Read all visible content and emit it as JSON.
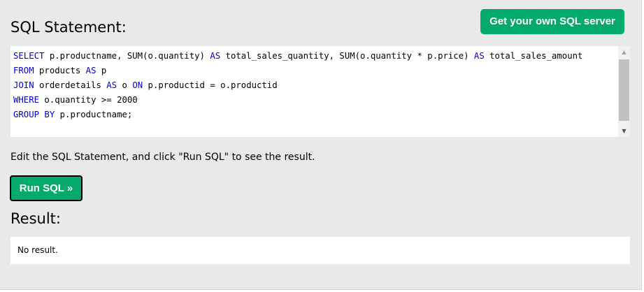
{
  "header": {
    "title": "SQL Statement:",
    "get_server_label": "Get your own SQL server"
  },
  "editor": {
    "lines": [
      [
        {
          "t": "SELECT",
          "kw": true
        },
        {
          "t": " p.productname, SUM(o.quantity) ",
          "kw": false
        },
        {
          "t": "AS",
          "kw": true
        },
        {
          "t": " total_sales_quantity, SUM(o.quantity * p.price) ",
          "kw": false
        },
        {
          "t": "AS",
          "kw": true
        },
        {
          "t": " total_sales_amount",
          "kw": false
        }
      ],
      [
        {
          "t": "FROM",
          "kw": true
        },
        {
          "t": " products ",
          "kw": false
        },
        {
          "t": "AS",
          "kw": true
        },
        {
          "t": " p",
          "kw": false
        }
      ],
      [
        {
          "t": "JOIN",
          "kw": true
        },
        {
          "t": " orderdetails ",
          "kw": false
        },
        {
          "t": "AS",
          "kw": true
        },
        {
          "t": " o ",
          "kw": false
        },
        {
          "t": "ON",
          "kw": true
        },
        {
          "t": " p.productid = o.productid",
          "kw": false
        }
      ],
      [
        {
          "t": "WHERE",
          "kw": true
        },
        {
          "t": " o.quantity >= 2000",
          "kw": false
        }
      ],
      [
        {
          "t": "GROUP BY",
          "kw": true
        },
        {
          "t": " p.productname;",
          "kw": false
        }
      ]
    ],
    "scroll_up_icon": "triangle-up-icon",
    "scroll_down_icon": "triangle-down-icon"
  },
  "instructions": {
    "text": "Edit the SQL Statement, and click \"Run SQL\" to see the result."
  },
  "run_button": {
    "label": "Run SQL »"
  },
  "result": {
    "title": "Result:",
    "text": "No result."
  },
  "colors": {
    "background": "#e7e9eb",
    "accent_green": "#04aa6d",
    "keyword_blue": "#0000cd"
  }
}
